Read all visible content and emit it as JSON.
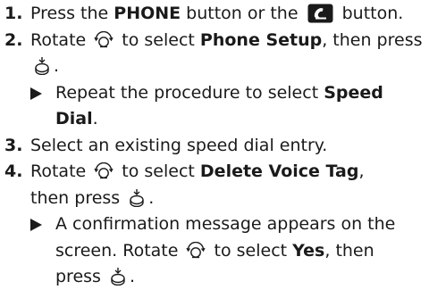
{
  "steps": [
    {
      "num": "1.",
      "parts": [
        "Press the ",
        "PHONE",
        " button or the ",
        " button."
      ]
    },
    {
      "num": "2.",
      "parts": [
        "Rotate ",
        " to select ",
        "Phone Setup",
        ", then press ",
        "."
      ],
      "sub": [
        "Repeat the procedure to select ",
        "Speed Dial",
        "."
      ]
    },
    {
      "num": "3.",
      "parts": [
        "Select an existing speed dial entry."
      ]
    },
    {
      "num": "4.",
      "parts": [
        "Rotate ",
        " to select ",
        "Delete Voice Tag",
        ",",
        "then press ",
        "."
      ],
      "sub": [
        "A confirmation message appears on the",
        "screen. Rotate ",
        " to select ",
        "Yes",
        ", then",
        "press ",
        "."
      ]
    }
  ],
  "icons": {
    "phone": "phone-button-icon",
    "rotate": "rotate-knob-icon",
    "press": "press-knob-icon"
  }
}
